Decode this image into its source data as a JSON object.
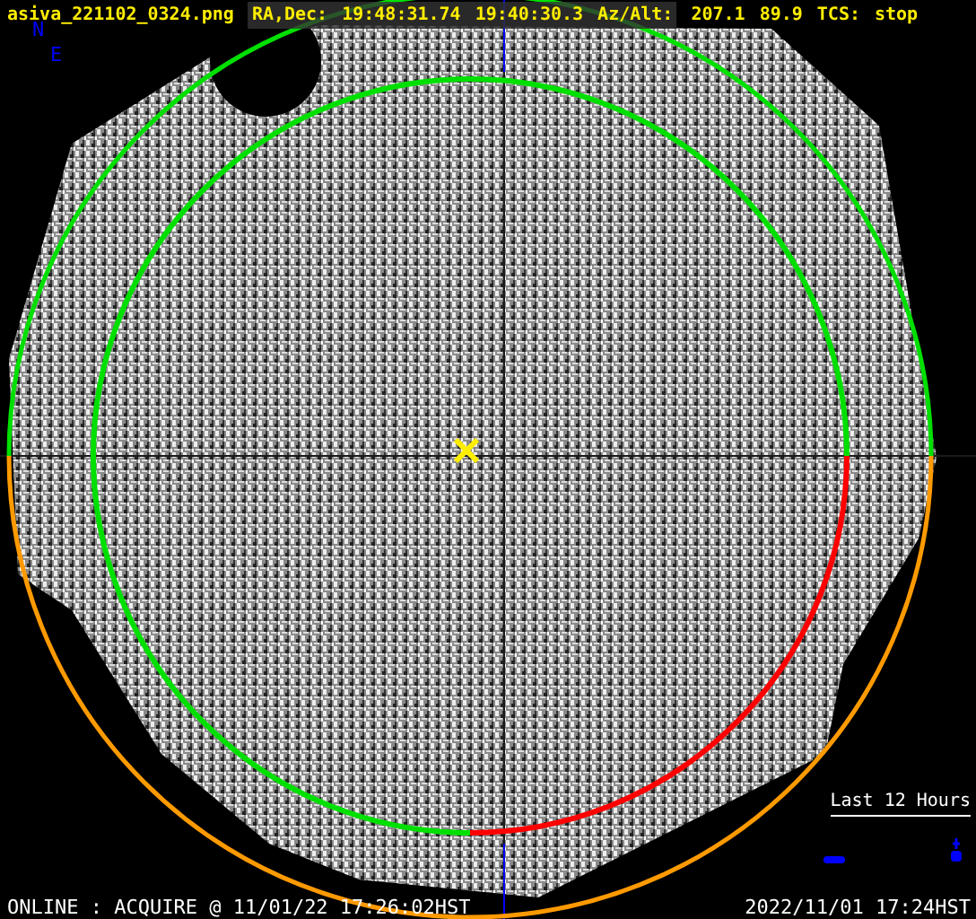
{
  "header": {
    "filename": "asiva_221102_0324.png",
    "radec_label": "RA,Dec:",
    "ra": "19:48:31.74",
    "dec": "19:40:30.3",
    "azalt_label": "Az/Alt:",
    "az": "207.1",
    "alt": "89.9",
    "tcs_label": "TCS:",
    "tcs": "stop"
  },
  "compass": {
    "north": "N",
    "east": "E"
  },
  "legend": {
    "title": "Last 12 Hours"
  },
  "status": {
    "left": "ONLINE : ACQUIRE @ 11/01/22 17:26:02HST",
    "right": "2022/11/01 17:24HST"
  }
}
